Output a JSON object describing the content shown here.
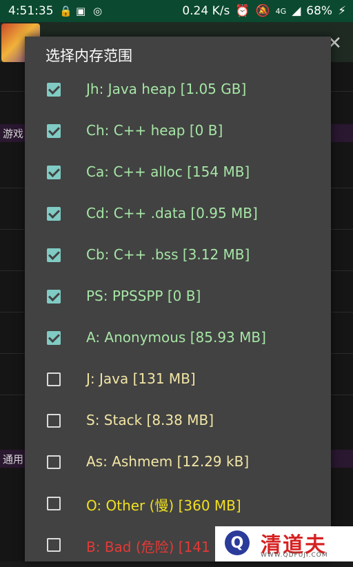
{
  "status_bar": {
    "time": "4:51:35",
    "speed": "0.24 K/s",
    "network": "4G",
    "battery": "68%"
  },
  "background": {
    "section_1": "游戏",
    "section_2": "通用"
  },
  "dialog": {
    "title": "选择内存范围",
    "options": [
      {
        "label": "Jh: Java heap [1.05 GB]",
        "checked": true,
        "color": "#a6e6a6"
      },
      {
        "label": "Ch: C++ heap [0 B]",
        "checked": true,
        "color": "#a6e6a6"
      },
      {
        "label": "Ca: C++ alloc [154 MB]",
        "checked": true,
        "color": "#a6e6a6"
      },
      {
        "label": "Cd: C++ .data [0.95 MB]",
        "checked": true,
        "color": "#a6e6a6"
      },
      {
        "label": "Cb: C++ .bss [3.12 MB]",
        "checked": true,
        "color": "#a6e6a6"
      },
      {
        "label": "PS: PPSSPP [0 B]",
        "checked": true,
        "color": "#a6e6a6"
      },
      {
        "label": "A: Anonymous [85.93 MB]",
        "checked": true,
        "color": "#a6e6a6"
      },
      {
        "label": "J: Java [131 MB]",
        "checked": false,
        "color": "#f2e6a6"
      },
      {
        "label": "S: Stack [8.38 MB]",
        "checked": false,
        "color": "#f2e6a6"
      },
      {
        "label": "As: Ashmem [12.29 kB]",
        "checked": false,
        "color": "#f2e6a6"
      },
      {
        "label": "O: Other (慢) [360 MB]",
        "checked": false,
        "color": "#f0e020"
      },
      {
        "label": "B: Bad (危险) [141",
        "checked": false,
        "color": "#e53935"
      }
    ]
  },
  "watermark": {
    "text": "清道夫",
    "url": "WWW.QDFUJI.COM"
  }
}
